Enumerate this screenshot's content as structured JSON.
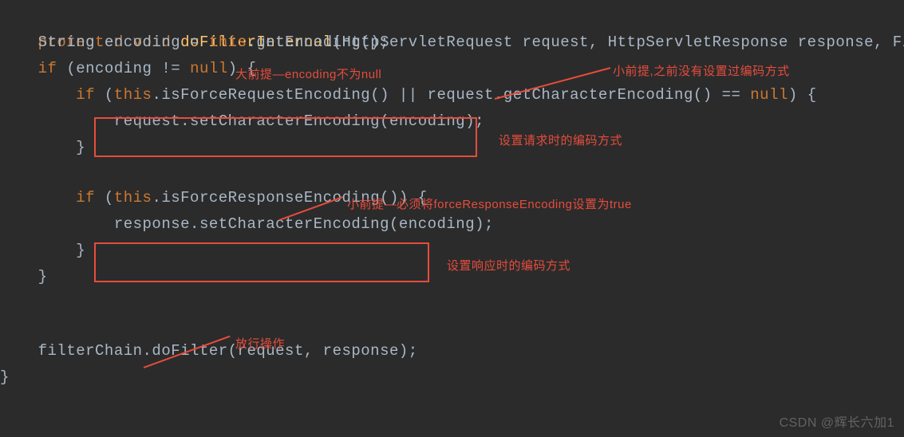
{
  "code": {
    "line1": {
      "kw_protected": "protected",
      "kw_void": "void",
      "method": "doFilterInternal",
      "params": "(HttpServletRequest request, HttpServletResponse response, FilterChain"
    },
    "line2": {
      "type": "String",
      "var": "encoding",
      "eq": " = ",
      "kw_this": "this",
      "call": ".getEncoding();"
    },
    "line3": {
      "kw_if": "if",
      "open": " (encoding != ",
      "kw_null": "null",
      "close": ") {"
    },
    "line4": {
      "kw_if": "if",
      "open": " (",
      "kw_this": "this",
      "mid": ".isForceRequestEncoding() || request.getCharacterEncoding() == ",
      "kw_null": "null",
      "close": ") {"
    },
    "line5": {
      "text": "request.setCharacterEncoding(encoding);"
    },
    "line6": {
      "text": "}"
    },
    "line7": {
      "kw_if": "if",
      "open": " (",
      "kw_this": "this",
      "close": ".isForceResponseEncoding()) {"
    },
    "line8": {
      "text": "response.setCharacterEncoding(encoding);"
    },
    "line9": {
      "text": "}"
    },
    "line10": {
      "text": "}"
    },
    "line11": {
      "text": "filterChain.doFilter(request, response);"
    },
    "line12": {
      "text": "}"
    }
  },
  "annotations": {
    "a1": "大前提—encoding不为null",
    "a2": "小前提,之前没有设置过编码方式",
    "a3": "设置请求时的编码方式",
    "a4": "小前提—必须将forceResponseEncoding设置为true",
    "a5": "设置响应时的编码方式",
    "a6": "放行操作"
  },
  "watermark": "CSDN @辉长六加1"
}
